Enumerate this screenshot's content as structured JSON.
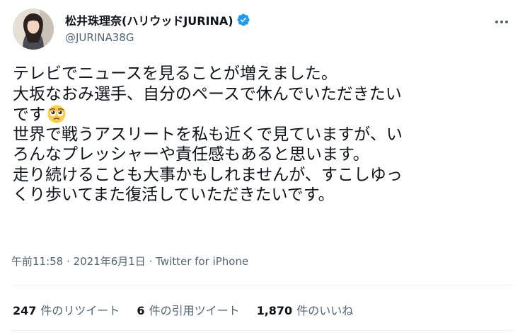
{
  "author": {
    "display_name": "松井珠理奈(ハリウッドJURINA)",
    "handle": "@JURINA38G",
    "avatar_icon": "profile-photo",
    "verified_icon": "verified-badge-icon"
  },
  "tweet": {
    "lines": [
      "テレビでニュースを見ることが増えました。",
      "大坂なおみ選手、自分のペースで休んでいただきたい",
      "です",
      "世界で戦うアスリートを私も近くで見ていますが、い",
      "ろんなプレッシャーや責任感もあると思います。",
      "走り続けることも大事かもしれませんが、すこしゆっ",
      "くり歩いてまた復活していただきたいです。"
    ],
    "emoji_name": "pleading-face-emoji"
  },
  "meta": {
    "time": "午前11:58",
    "separator1": " · ",
    "date": "2021年6月1日",
    "separator2": " · ",
    "source": "Twitter for iPhone"
  },
  "stats": {
    "retweets_count": "247",
    "retweets_label": "件のリツイート",
    "quotes_count": "6",
    "quotes_label": "件の引用ツイート",
    "likes_count": "1,870",
    "likes_label": "件のいいね"
  },
  "colors": {
    "text": "#0f1419",
    "secondary": "#536471",
    "verified": "#1d9bf0",
    "divider": "#eff3f4"
  }
}
